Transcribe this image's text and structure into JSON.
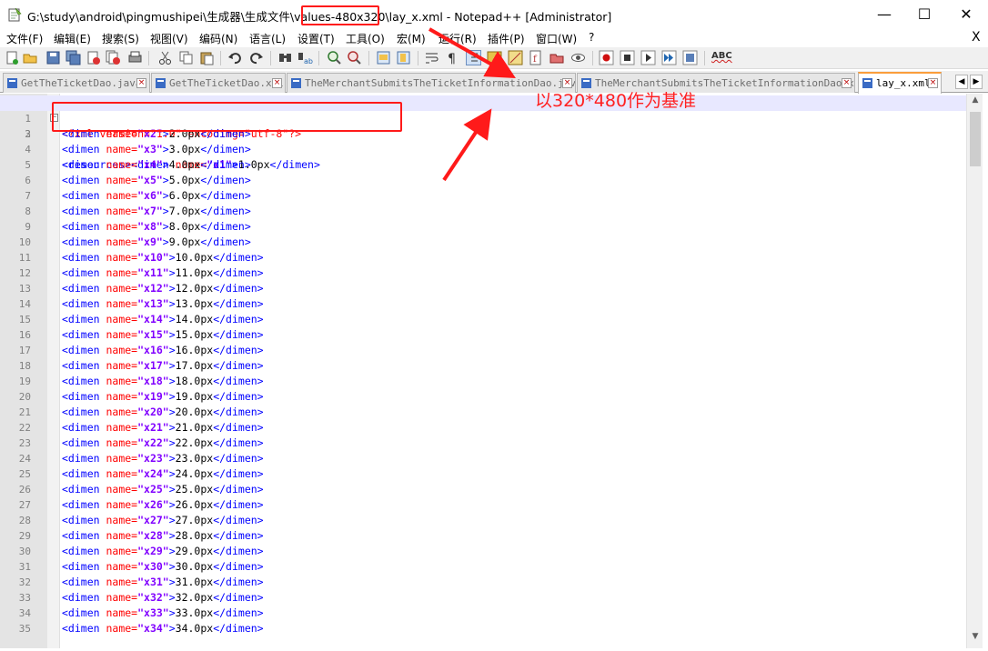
{
  "window": {
    "title": "G:\\study\\android\\pingmushipei\\生成器\\生成文件\\values-480x320\\lay_x.xml - Notepad++ [Administrator]",
    "minimize": "—",
    "maximize": "☐",
    "close": "✕"
  },
  "menu": {
    "items": [
      "文件(F)",
      "编辑(E)",
      "搜索(S)",
      "视图(V)",
      "编码(N)",
      "语言(L)",
      "设置(T)",
      "工具(O)",
      "宏(M)",
      "运行(R)",
      "插件(P)",
      "窗口(W)",
      "?"
    ],
    "close": "X"
  },
  "toolbar": {
    "icons": [
      "new-file-icon",
      "open-file-icon",
      "save-icon",
      "save-all-icon",
      "close-icon",
      "close-all-icon",
      "print-icon",
      "cut-icon",
      "copy-icon",
      "paste-icon",
      "undo-icon",
      "redo-icon",
      "find-icon",
      "replace-icon",
      "zoom-in-icon",
      "zoom-out-icon",
      "sync-v-icon",
      "sync-h-icon",
      "wrap-icon",
      "all-chars-icon",
      "indent-guide-icon",
      "udl-icon",
      "doc-map-icon",
      "func-list-icon",
      "folder-icon",
      "monitor-icon",
      "record-icon",
      "stop-icon",
      "play-icon",
      "play-multi-icon",
      "save-macro-icon"
    ],
    "spellcheck_label": "ABC"
  },
  "tabs": [
    {
      "label": "GetTheTicketDao.java",
      "active": false
    },
    {
      "label": "GetTheTicketDao.xml",
      "active": false
    },
    {
      "label": "TheMerchantSubmitsTheTicketInformationDao.java",
      "active": false
    },
    {
      "label": "TheMerchantSubmitsTheTicketInformationDao.xml",
      "active": false
    },
    {
      "label": "lay_x.xml",
      "active": true
    }
  ],
  "editor": {
    "line1": {
      "num": "1",
      "decl": "<?xml version=\"1.0\" encoding=\"utf-8\"?>"
    },
    "line2": {
      "num": "2",
      "open_tag": "<resources><dimen ",
      "attr": "name=",
      "val": "\"x1\"",
      "gt": ">",
      "text": "1.0px",
      "close": "</dimen>"
    },
    "dimen_lines": [
      {
        "num": "3",
        "key": "\"x2\"",
        "value": "2.0px"
      },
      {
        "num": "4",
        "key": "\"x3\"",
        "value": "3.0px"
      },
      {
        "num": "5",
        "key": "\"x4\"",
        "value": "4.0px"
      },
      {
        "num": "6",
        "key": "\"x5\"",
        "value": "5.0px"
      },
      {
        "num": "7",
        "key": "\"x6\"",
        "value": "6.0px"
      },
      {
        "num": "8",
        "key": "\"x7\"",
        "value": "7.0px"
      },
      {
        "num": "9",
        "key": "\"x8\"",
        "value": "8.0px"
      },
      {
        "num": "10",
        "key": "\"x9\"",
        "value": "9.0px"
      },
      {
        "num": "11",
        "key": "\"x10\"",
        "value": "10.0px"
      },
      {
        "num": "12",
        "key": "\"x11\"",
        "value": "11.0px"
      },
      {
        "num": "13",
        "key": "\"x12\"",
        "value": "12.0px"
      },
      {
        "num": "14",
        "key": "\"x13\"",
        "value": "13.0px"
      },
      {
        "num": "15",
        "key": "\"x14\"",
        "value": "14.0px"
      },
      {
        "num": "16",
        "key": "\"x15\"",
        "value": "15.0px"
      },
      {
        "num": "17",
        "key": "\"x16\"",
        "value": "16.0px"
      },
      {
        "num": "18",
        "key": "\"x17\"",
        "value": "17.0px"
      },
      {
        "num": "19",
        "key": "\"x18\"",
        "value": "18.0px"
      },
      {
        "num": "20",
        "key": "\"x19\"",
        "value": "19.0px"
      },
      {
        "num": "21",
        "key": "\"x20\"",
        "value": "20.0px"
      },
      {
        "num": "22",
        "key": "\"x21\"",
        "value": "21.0px"
      },
      {
        "num": "23",
        "key": "\"x22\"",
        "value": "22.0px"
      },
      {
        "num": "24",
        "key": "\"x23\"",
        "value": "23.0px"
      },
      {
        "num": "25",
        "key": "\"x24\"",
        "value": "24.0px"
      },
      {
        "num": "26",
        "key": "\"x25\"",
        "value": "25.0px"
      },
      {
        "num": "27",
        "key": "\"x26\"",
        "value": "26.0px"
      },
      {
        "num": "28",
        "key": "\"x27\"",
        "value": "27.0px"
      },
      {
        "num": "29",
        "key": "\"x28\"",
        "value": "28.0px"
      },
      {
        "num": "30",
        "key": "\"x29\"",
        "value": "29.0px"
      },
      {
        "num": "31",
        "key": "\"x30\"",
        "value": "30.0px"
      },
      {
        "num": "32",
        "key": "\"x31\"",
        "value": "31.0px"
      },
      {
        "num": "33",
        "key": "\"x32\"",
        "value": "32.0px"
      },
      {
        "num": "34",
        "key": "\"x33\"",
        "value": "33.0px"
      },
      {
        "num": "35",
        "key": "\"x34\"",
        "value": "34.0px"
      }
    ],
    "tag_open": "<dimen ",
    "attr_name": "name=",
    "tag_close": "</dimen>"
  },
  "annotation": {
    "text": "以320*480作为基准",
    "color": "#ff2020"
  }
}
